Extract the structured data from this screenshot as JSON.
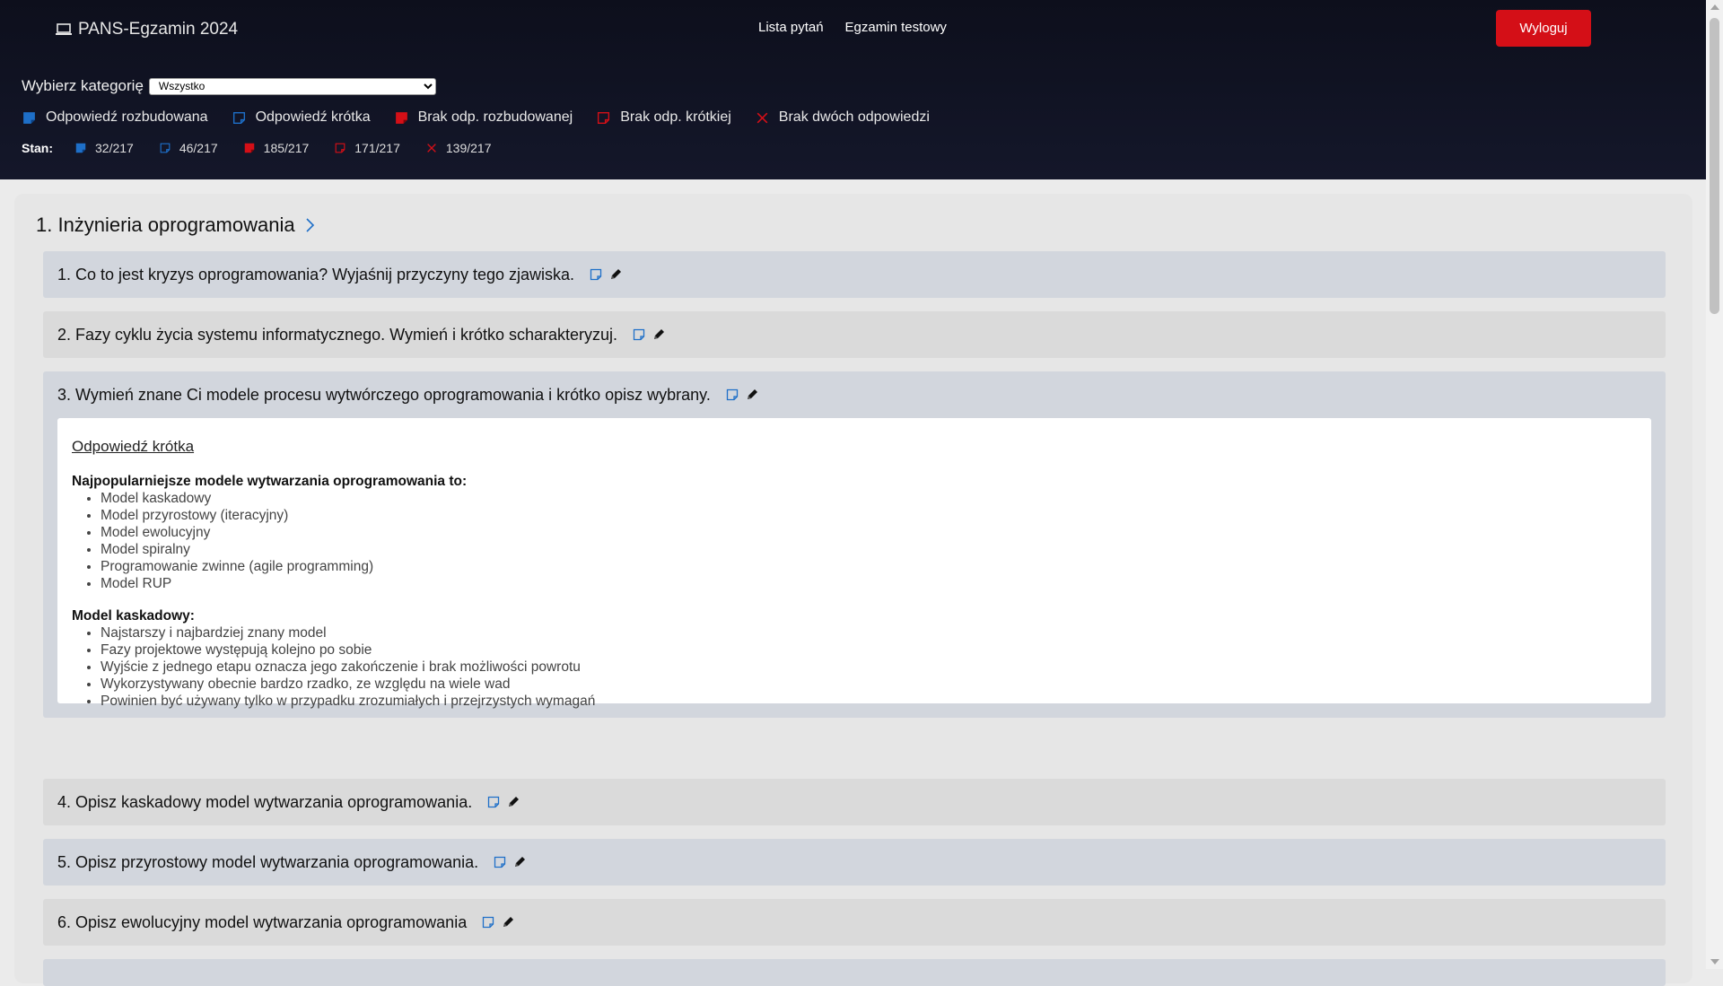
{
  "header": {
    "brand": "PANS-Egzamin 2024",
    "nav": [
      "Lista pytań",
      "Egzamin testowy"
    ],
    "logout": "Wyloguj"
  },
  "filter": {
    "label": "Wybierz kategorię",
    "selected": "Wszystko"
  },
  "legend": [
    {
      "label": "Odpowiedź rozbudowana",
      "icon": "filled-blue-note-icon"
    },
    {
      "label": "Odpowiedź krótka",
      "icon": "outline-blue-note-icon"
    },
    {
      "label": "Brak odp. rozbudowanej",
      "icon": "filled-red-note-icon"
    },
    {
      "label": "Brak odp. krótkiej",
      "icon": "outline-red-note-icon"
    },
    {
      "label": "Brak dwóch odpowiedzi",
      "icon": "red-x-icon"
    }
  ],
  "status": {
    "label": "Stan:",
    "values": [
      "32/217",
      "46/217",
      "185/217",
      "171/217",
      "139/217"
    ]
  },
  "colors": {
    "blue": "#1e6fc8",
    "red": "#d40f17",
    "header_bg": "#0d0f1c"
  },
  "section": {
    "title": "1. Inżynieria oprogramowania"
  },
  "questions": [
    "1. Co to jest kryzys oprogramowania? Wyjaśnij przyczyny tego zjawiska.",
    "2. Fazy cyklu życia systemu informatycznego. Wymień i krótko scharakteryzuj.",
    "3. Wymień znane Ci modele procesu wytwórczego oprogramowania i krótko opisz wybrany.",
    "4. Opisz kaskadowy model wytwarzania oprogramowania.",
    "5. Opisz przyrostowy model wytwarzania oprogramowania.",
    "6. Opisz ewolucyjny model wytwarzania oprogramowania"
  ],
  "answer": {
    "title": "Odpowiedź krótka",
    "heading1": "Najpopularniejsze modele wytwarzania oprogramowania to:",
    "list1": [
      "Model kaskadowy",
      "Model przyrostowy (iteracyjny)",
      "Model ewolucyjny",
      "Model spiralny",
      "Programowanie zwinne (agile programming)",
      "Model RUP"
    ],
    "heading2": "Model kaskadowy:",
    "list2": [
      "Najstarszy i najbardziej znany model",
      "Fazy projektowe występują kolejno po sobie",
      "Wyjście z jednego etapu oznacza jego zakończenie i brak możliwości powrotu",
      "Wykorzystywany obecnie bardzo rzadko, ze względu na wiele wad",
      "Powinien być używany tylko w przypadku zrozumiałych i przejrzystych wymagań"
    ]
  }
}
